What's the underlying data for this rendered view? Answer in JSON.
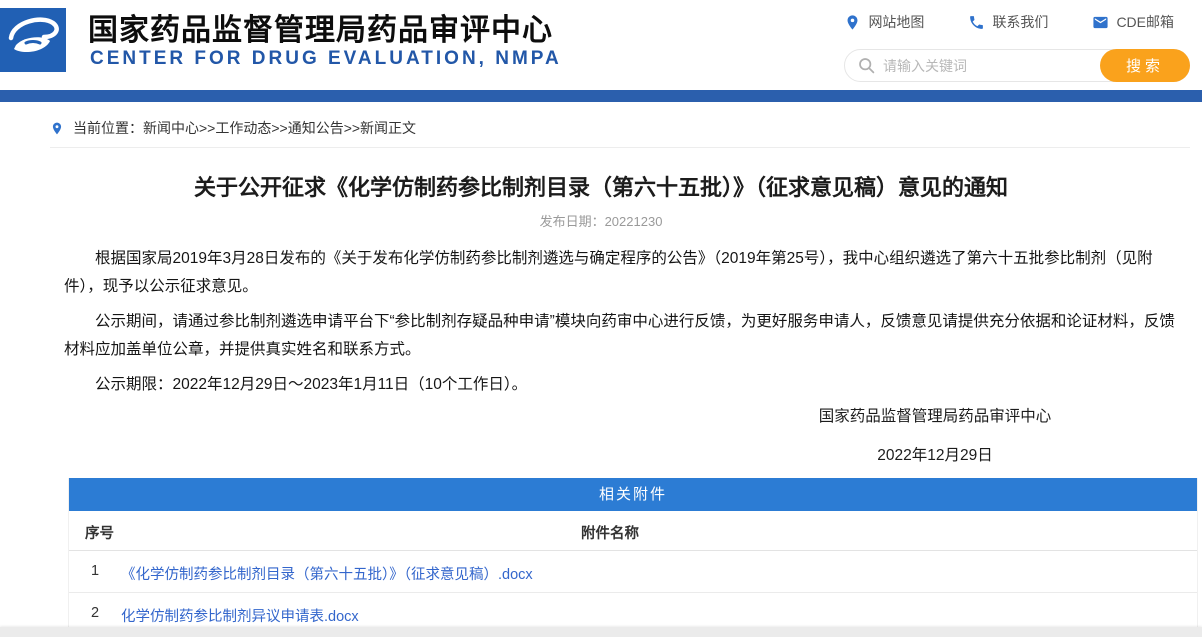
{
  "header": {
    "org_title_cn": "国家药品监督管理局药品审评中心",
    "org_title_en": "CENTER FOR DRUG EVALUATION, NMPA",
    "links": [
      {
        "label": "网站地图",
        "icon": "location-pin-icon"
      },
      {
        "label": "联系我们",
        "icon": "phone-icon"
      },
      {
        "label": "CDE邮箱",
        "icon": "mail-icon"
      }
    ],
    "search": {
      "placeholder": "请输入关键词",
      "button_label": "搜索"
    }
  },
  "breadcrumb": {
    "text": "当前位置：新闻中心>>工作动态>>通知公告>>新闻正文"
  },
  "article": {
    "title": "关于公开征求《化学仿制药参比制剂目录（第六十五批）》（征求意见稿）意见的通知",
    "publish_date": "发布日期：20221230",
    "paragraphs": [
      "根据国家局2019年3月28日发布的《关于发布化学仿制药参比制剂遴选与确定程序的公告》（2019年第25号），我中心组织遴选了第六十五批参比制剂（见附件），现予以公示征求意见。",
      "公示期间，请通过参比制剂遴选申请平台下“参比制剂存疑品种申请”模块向药审中心进行反馈，为更好服务申请人，反馈意见请提供充分依据和论证材料，反馈材料应加盖单位公章，并提供真实姓名和联系方式。",
      "公示期限：2022年12月29日～2023年1月11日（10个工作日）。"
    ],
    "signature": "国家药品监督管理局药品审评中心",
    "signature_date": "2022年12月29日"
  },
  "attachments": {
    "section_title": "相关附件",
    "columns": {
      "index": "序号",
      "name": "附件名称"
    },
    "rows": [
      {
        "index": "1",
        "name": "《化学仿制药参比制剂目录（第六十五批）》（征求意见稿）.docx"
      },
      {
        "index": "2",
        "name": "化学仿制药参比制剂异议申请表.docx"
      }
    ]
  },
  "colors": {
    "brand_blue": "#2160b4",
    "nav_bar_blue": "#2b5fad",
    "table_header_blue": "#2c7cd4",
    "icon_link_blue": "#2f72cc",
    "search_button_orange": "#faa21c",
    "hyperlink_blue": "#3366cc"
  }
}
